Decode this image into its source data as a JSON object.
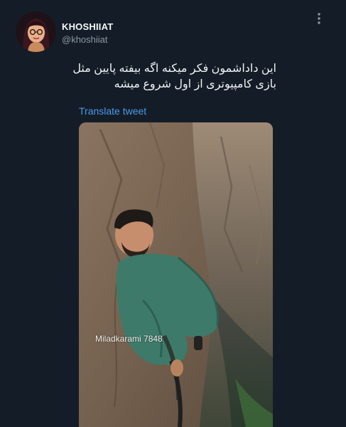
{
  "author": {
    "display_name": "KHOSHIIAT",
    "handle": "@khoshiiat",
    "avatar_icon": "cartoon-woman-avatar-icon"
  },
  "tweet": {
    "text_line1": "این داداشمون فکر میکنه اگه بیفته پایین مثل",
    "text_line2": "بازی کامپیوتری از اول شروع میشه",
    "translate_label": "Translate tweet"
  },
  "media": {
    "watermark": "Miladkarami 7848"
  },
  "colors": {
    "background": "#141d27",
    "link": "#4a99e9",
    "secondary_text": "#8b98a5"
  },
  "icons": {
    "more": "more-vertical-icon"
  }
}
